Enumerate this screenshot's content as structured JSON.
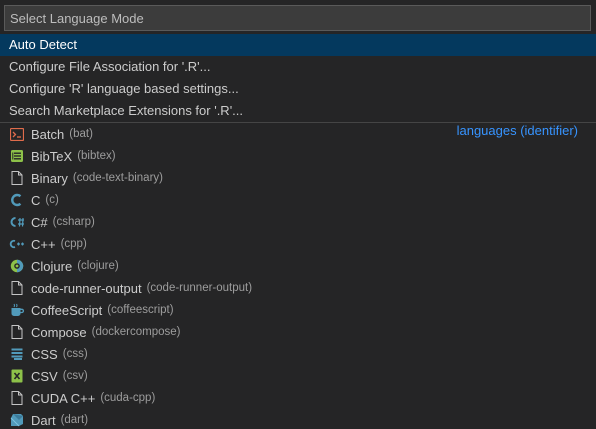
{
  "input": {
    "placeholder": "Select Language Mode"
  },
  "actions": [
    {
      "label": "Auto Detect"
    },
    {
      "label": "Configure File Association for '.R'..."
    },
    {
      "label": "Configure 'R' language based settings..."
    },
    {
      "label": "Search Marketplace Extensions for '.R'..."
    }
  ],
  "group_label": "languages (identifier)",
  "languages": [
    {
      "name": "Batch",
      "id": "(bat)",
      "icon": "terminal-icon"
    },
    {
      "name": "BibTeX",
      "id": "(bibtex)",
      "icon": "bibtex-icon"
    },
    {
      "name": "Binary",
      "id": "(code-text-binary)",
      "icon": "file-icon"
    },
    {
      "name": "C",
      "id": "(c)",
      "icon": "c-icon"
    },
    {
      "name": "C#",
      "id": "(csharp)",
      "icon": "csharp-icon"
    },
    {
      "name": "C++",
      "id": "(cpp)",
      "icon": "cpp-icon"
    },
    {
      "name": "Clojure",
      "id": "(clojure)",
      "icon": "clojure-icon"
    },
    {
      "name": "code-runner-output",
      "id": "(code-runner-output)",
      "icon": "file-icon"
    },
    {
      "name": "CoffeeScript",
      "id": "(coffeescript)",
      "icon": "coffee-icon"
    },
    {
      "name": "Compose",
      "id": "(dockercompose)",
      "icon": "file-icon"
    },
    {
      "name": "CSS",
      "id": "(css)",
      "icon": "css-icon"
    },
    {
      "name": "CSV",
      "id": "(csv)",
      "icon": "csv-icon"
    },
    {
      "name": "CUDA C++",
      "id": "(cuda-cpp)",
      "icon": "file-icon"
    },
    {
      "name": "Dart",
      "id": "(dart)",
      "icon": "dart-icon"
    }
  ],
  "colors": {
    "background": "#252526",
    "selected": "#04395e",
    "accent": "#3794ff"
  }
}
